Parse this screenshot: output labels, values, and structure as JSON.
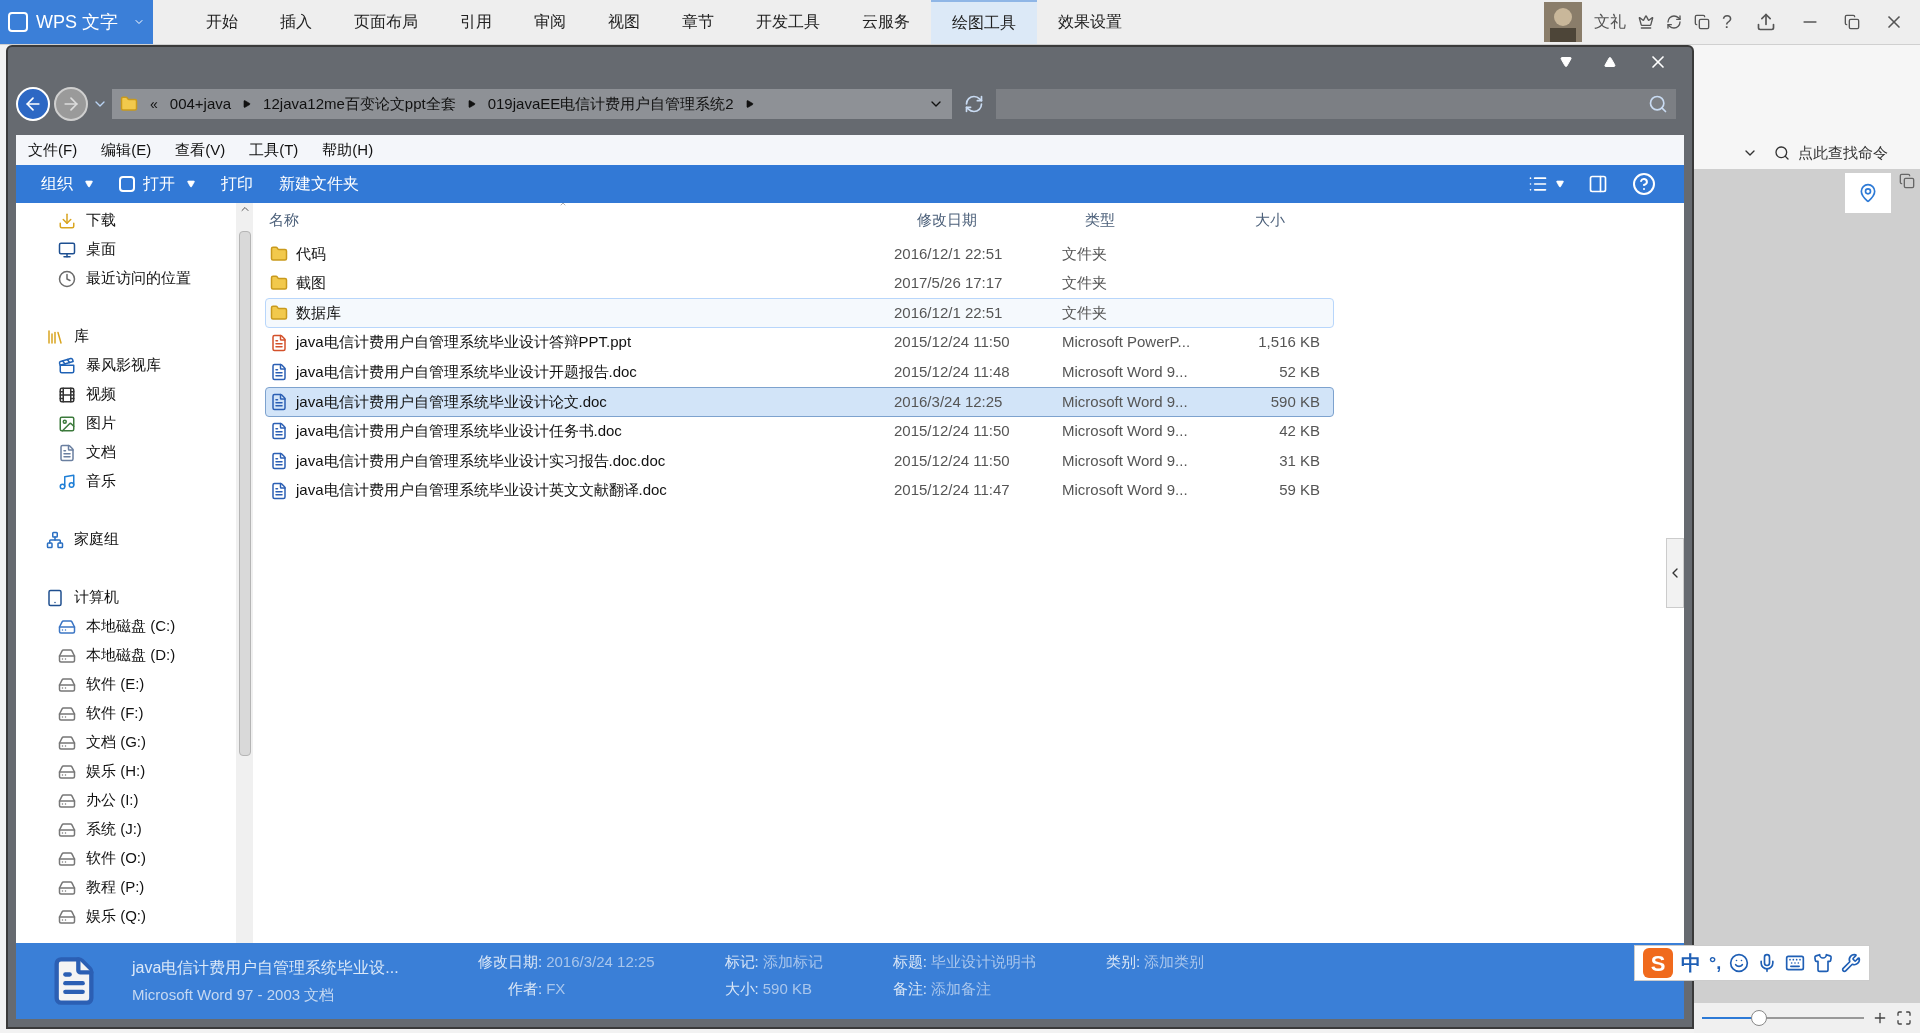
{
  "wps": {
    "app_name": "WPS 文字",
    "tabs": [
      {
        "label": "开始",
        "selected": false
      },
      {
        "label": "插入",
        "selected": false
      },
      {
        "label": "页面布局",
        "selected": false
      },
      {
        "label": "引用",
        "selected": false
      },
      {
        "label": "审阅",
        "selected": false
      },
      {
        "label": "视图",
        "selected": false
      },
      {
        "label": "章节",
        "selected": false
      },
      {
        "label": "开发工具",
        "selected": false
      },
      {
        "label": "云服务",
        "selected": false
      },
      {
        "label": "绘图工具",
        "selected": true
      },
      {
        "label": "效果设置",
        "selected": false
      }
    ],
    "user": "文礼",
    "help": "?",
    "command_search": {
      "placeholder": "点此查找命令"
    }
  },
  "explorer": {
    "breadcrumbs": [
      "004+java",
      "12java12me百变论文ppt全套",
      "019javaEE电信计费用户自管理系统2"
    ],
    "menu": [
      "文件(F)",
      "编辑(E)",
      "查看(V)",
      "工具(T)",
      "帮助(H)"
    ],
    "toolbar": [
      {
        "label": "组织",
        "kind": "dropdown"
      },
      {
        "label": "打开",
        "kind": "open"
      },
      {
        "label": "打印",
        "kind": "button"
      },
      {
        "label": "新建文件夹",
        "kind": "button"
      }
    ],
    "overflow_mark": "«",
    "nav": [
      {
        "children": [
          {
            "label": "下载",
            "kind": "download"
          },
          {
            "label": "桌面",
            "kind": "desktop"
          },
          {
            "label": "最近访问的位置",
            "kind": "recent"
          }
        ]
      },
      {
        "label": "库",
        "kind": "library",
        "children": [
          {
            "label": "暴风影视库",
            "kind": "media"
          },
          {
            "label": "视频",
            "kind": "video"
          },
          {
            "label": "图片",
            "kind": "picture"
          },
          {
            "label": "文档",
            "kind": "document"
          },
          {
            "label": "音乐",
            "kind": "music"
          }
        ]
      },
      {
        "label": "家庭组",
        "kind": "homegroup"
      },
      {
        "label": "计算机",
        "kind": "computer",
        "children": [
          {
            "label": "本地磁盘 (C:)",
            "kind": "system"
          },
          {
            "label": "本地磁盘 (D:)",
            "kind": "drive"
          },
          {
            "label": "软件 (E:)",
            "kind": "drive"
          },
          {
            "label": "软件 (F:)",
            "kind": "drive"
          },
          {
            "label": "文档 (G:)",
            "kind": "drive"
          },
          {
            "label": "娱乐 (H:)",
            "kind": "drive"
          },
          {
            "label": "办公 (I:)",
            "kind": "drive"
          },
          {
            "label": "系统 (J:)",
            "kind": "drive"
          },
          {
            "label": "软件 (O:)",
            "kind": "drive"
          },
          {
            "label": "教程 (P:)",
            "kind": "drive"
          },
          {
            "label": "娱乐 (Q:)",
            "kind": "drive"
          }
        ]
      }
    ],
    "columns": [
      "名称",
      "修改日期",
      "类型",
      "大小"
    ],
    "rows": [
      {
        "name": "代码",
        "date": "2016/12/1 22:51",
        "type": "文件夹",
        "size": "",
        "kind": "folder",
        "selected": false,
        "hovered": false
      },
      {
        "name": "截图",
        "date": "2017/5/26 17:17",
        "type": "文件夹",
        "size": "",
        "kind": "folder",
        "selected": false,
        "hovered": false
      },
      {
        "name": "数据库",
        "date": "2016/12/1 22:51",
        "type": "文件夹",
        "size": "",
        "kind": "folder",
        "selected": false,
        "hovered": true
      },
      {
        "name": "java电信计费用户自管理系统毕业设计答辩PPT.ppt",
        "date": "2015/12/24 11:50",
        "type": "Microsoft PowerP...",
        "size": "1,516 KB",
        "kind": "ppt",
        "selected": false,
        "hovered": false
      },
      {
        "name": "java电信计费用户自管理系统毕业设计开题报告.doc",
        "date": "2015/12/24 11:48",
        "type": "Microsoft Word 9...",
        "size": "52 KB",
        "kind": "doc",
        "selected": false,
        "hovered": false
      },
      {
        "name": "java电信计费用户自管理系统毕业设计论文.doc",
        "date": "2016/3/24 12:25",
        "type": "Microsoft Word 9...",
        "size": "590 KB",
        "kind": "doc",
        "selected": true,
        "hovered": false
      },
      {
        "name": "java电信计费用户自管理系统毕业设计任务书.doc",
        "date": "2015/12/24 11:50",
        "type": "Microsoft Word 9...",
        "size": "42 KB",
        "kind": "doc",
        "selected": false,
        "hovered": false
      },
      {
        "name": "java电信计费用户自管理系统毕业设计实习报告.doc.doc",
        "date": "2015/12/24 11:50",
        "type": "Microsoft Word 9...",
        "size": "31 KB",
        "kind": "doc",
        "selected": false,
        "hovered": false
      },
      {
        "name": "java电信计费用户自管理系统毕业设计英文文献翻译.doc",
        "date": "2015/12/24 11:47",
        "type": "Microsoft Word 9...",
        "size": "59 KB",
        "kind": "doc",
        "selected": false,
        "hovered": false
      }
    ],
    "details": {
      "name": "java电信计费用户自管理系统毕业设...",
      "type": "Microsoft Word 97 - 2003 文档",
      "columns": [
        [
          {
            "label": "修改日期:",
            "value": "2016/3/24 12:25"
          },
          {
            "label": "作者:",
            "value": "FX"
          }
        ],
        [
          {
            "label": "标记:",
            "value": "添加标记"
          },
          {
            "label": "大小:",
            "value": "590 KB"
          }
        ],
        [
          {
            "label": "标题:",
            "value": "毕业设计说明书"
          },
          {
            "label": "备注:",
            "value": "添加备注"
          }
        ],
        [
          {
            "label": "类别:",
            "value": "添加类别"
          }
        ]
      ]
    }
  },
  "ime": {
    "logo": "S",
    "mode": "中",
    "punct": "°,"
  },
  "zoom_slider": {
    "level": 0.35
  }
}
